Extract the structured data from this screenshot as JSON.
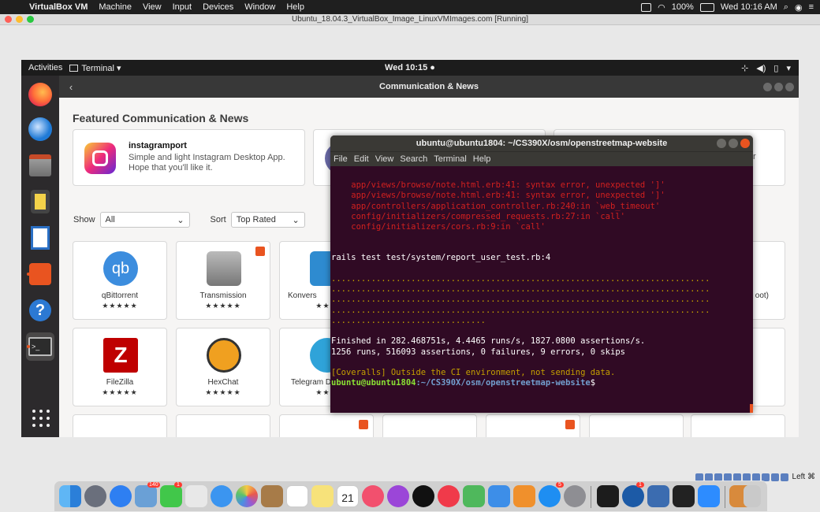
{
  "mac_menubar": {
    "apple_icon": "apple-icon",
    "items": [
      "VirtualBox VM",
      "Machine",
      "View",
      "Input",
      "Devices",
      "Window",
      "Help"
    ],
    "battery": "100%",
    "clock": "Wed 10:16 AM"
  },
  "vbox_window": {
    "title": "Ubuntu_18.04.3_VirtualBox_Image_LinuxVMImages.com [Running]",
    "host_key": "Left ⌘"
  },
  "ubuntu_topbar": {
    "activities": "Activities",
    "app": "Terminal ▾",
    "clock": "Wed 10:15 ●"
  },
  "software": {
    "header_title": "Communication & News",
    "featured_title": "Featured Communication & News",
    "featured": {
      "name": "instagramport",
      "description": "Simple and light Instagram Desktop App. Hope that you'll like it."
    },
    "show_label": "Show",
    "show_value": "All",
    "sort_label": "Sort",
    "sort_value": "Top Rated",
    "tiles": [
      {
        "name": "qBittorrent",
        "stars": "★★★★★"
      },
      {
        "name": "Transmission",
        "stars": "★★★★★"
      },
      {
        "name": "Konvers",
        "stars": "★★★"
      },
      {
        "name": "FileZilla",
        "stars": "★★★★★"
      },
      {
        "name": "HexChat",
        "stars": "★★★★★"
      },
      {
        "name": "Telegram D",
        "stars": "★★★"
      }
    ],
    "right_partial": "oot)",
    "right_partial_top": "r"
  },
  "terminal": {
    "title": "ubuntu@ubuntu1804: ~/CS390X/osm/openstreetmap-website",
    "menu": [
      "File",
      "Edit",
      "View",
      "Search",
      "Terminal",
      "Help"
    ],
    "error_lines": [
      "    app/views/browse/note.html.erb:41: syntax error, unexpected ']'",
      "    app/views/browse/note.html.erb:41: syntax error, unexpected ']'",
      "    app/controllers/application_controller.rb:240:in `web_timeout'",
      "    config/initializers/compressed_requests.rb:27:in `call'",
      "    config/initializers/cors.rb:9:in `call'"
    ],
    "test_cmd": "rails test test/system/report_user_test.rb:4",
    "dot_lines": [
      "............................................................................",
      "............................................................................",
      "............................................................................",
      "............................................................................",
      "..............................."
    ],
    "finished": "Finished in 282.468751s, 4.4465 runs/s, 1827.0800 assertions/s.",
    "summary": "1256 runs, 516093 assertions, 0 failures, 9 errors, 0 skips",
    "coveralls": "[Coveralls] Outside the CI environment, not sending data.",
    "prompt_user": "ubuntu@ubuntu1804",
    "prompt_path": ":~/CS390X/osm/openstreetmap-website",
    "prompt_end": "$"
  },
  "mac_dock": {
    "calendar_day": "21",
    "badges": [
      "140",
      "1",
      "5",
      "1"
    ]
  },
  "colors": {
    "ubuntu_orange": "#e95420",
    "terminal_bg": "#300a24",
    "error_red": "#d2201f",
    "warn_yellow": "#c4a000",
    "prompt_green": "#8ae234",
    "prompt_blue": "#729fcf"
  }
}
